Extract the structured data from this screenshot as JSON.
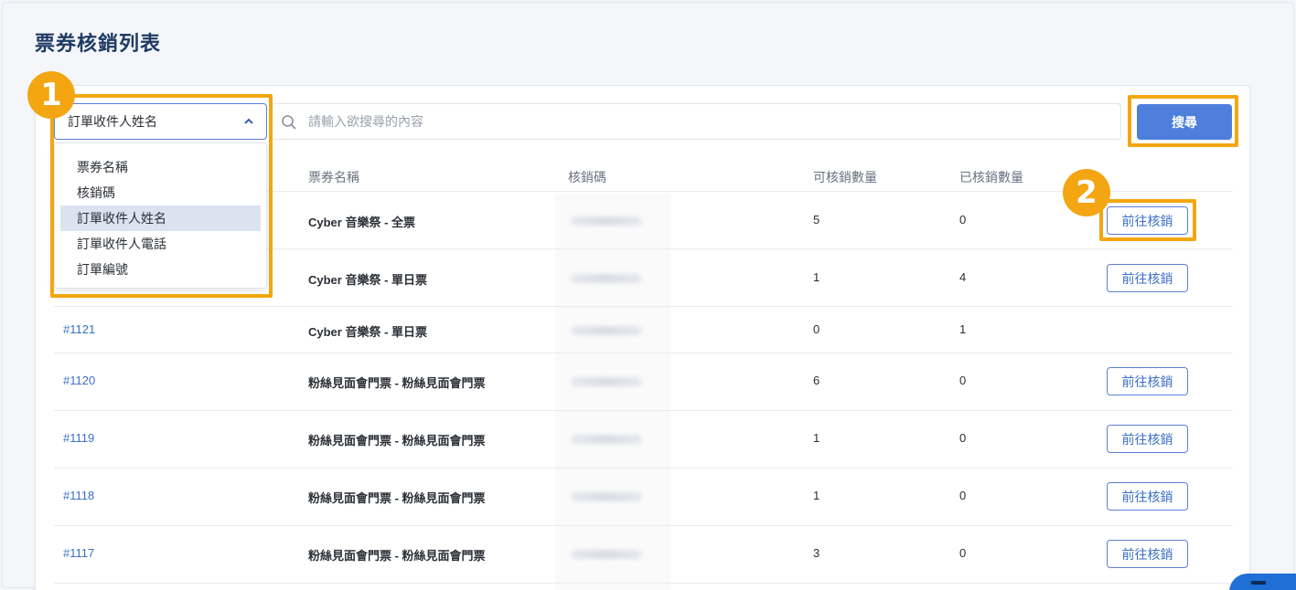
{
  "page": {
    "title": "票券核銷列表"
  },
  "filter": {
    "selected": "訂單收件人姓名",
    "options": [
      "票券名稱",
      "核銷碼",
      "訂單收件人姓名",
      "訂單收件人電話",
      "訂單編號"
    ],
    "active_index": 2
  },
  "search": {
    "placeholder": "請輸入欲搜尋的內容",
    "button_label": "搜尋"
  },
  "table": {
    "headers": [
      "票券名稱",
      "核銷碼",
      "可核銷數量",
      "已核銷數量"
    ],
    "rows": [
      {
        "id": "",
        "name": "Cyber 音樂祭 - 全票",
        "available": "5",
        "used": "0",
        "action": "前往核銷"
      },
      {
        "id": "",
        "name": "Cyber 音樂祭 - 單日票",
        "available": "1",
        "used": "4",
        "action": "前往核銷"
      },
      {
        "id": "#1121",
        "name": "Cyber 音樂祭 - 單日票",
        "available": "0",
        "used": "1",
        "action": ""
      },
      {
        "id": "#1120",
        "name": "粉絲見面會門票 - 粉絲見面會門票",
        "available": "6",
        "used": "0",
        "action": "前往核銷"
      },
      {
        "id": "#1119",
        "name": "粉絲見面會門票 - 粉絲見面會門票",
        "available": "1",
        "used": "0",
        "action": "前往核銷"
      },
      {
        "id": "#1118",
        "name": "粉絲見面會門票 - 粉絲見面會門票",
        "available": "1",
        "used": "0",
        "action": "前往核銷"
      },
      {
        "id": "#1117",
        "name": "粉絲見面會門票 - 粉絲見面會門票",
        "available": "3",
        "used": "0",
        "action": "前往核銷"
      }
    ]
  },
  "annotations": {
    "badge_1": "1",
    "badge_2": "2",
    "color": "#f3a611"
  }
}
